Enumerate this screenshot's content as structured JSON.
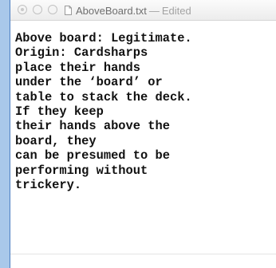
{
  "window": {
    "title": "AboveBoard.txt",
    "separator": "—",
    "status": "Edited"
  },
  "document": {
    "lines": [
      "Above board: Legitimate.",
      "Origin: Cardsharps",
      "place their hands",
      "under the ‘board’ or",
      "table to stack the deck.",
      "If they keep",
      "their hands above the",
      "board, they",
      "can be presumed to be",
      "performing without",
      "trickery."
    ]
  },
  "icons": {
    "close": "close-button-icon",
    "minimize": "minimize-button-icon",
    "zoom": "zoom-button-icon",
    "document": "document-icon"
  },
  "colors": {
    "desktop_edge": "#a9c8ea",
    "title_text": "#6f6f6f",
    "status_text": "#a3a3a3"
  }
}
